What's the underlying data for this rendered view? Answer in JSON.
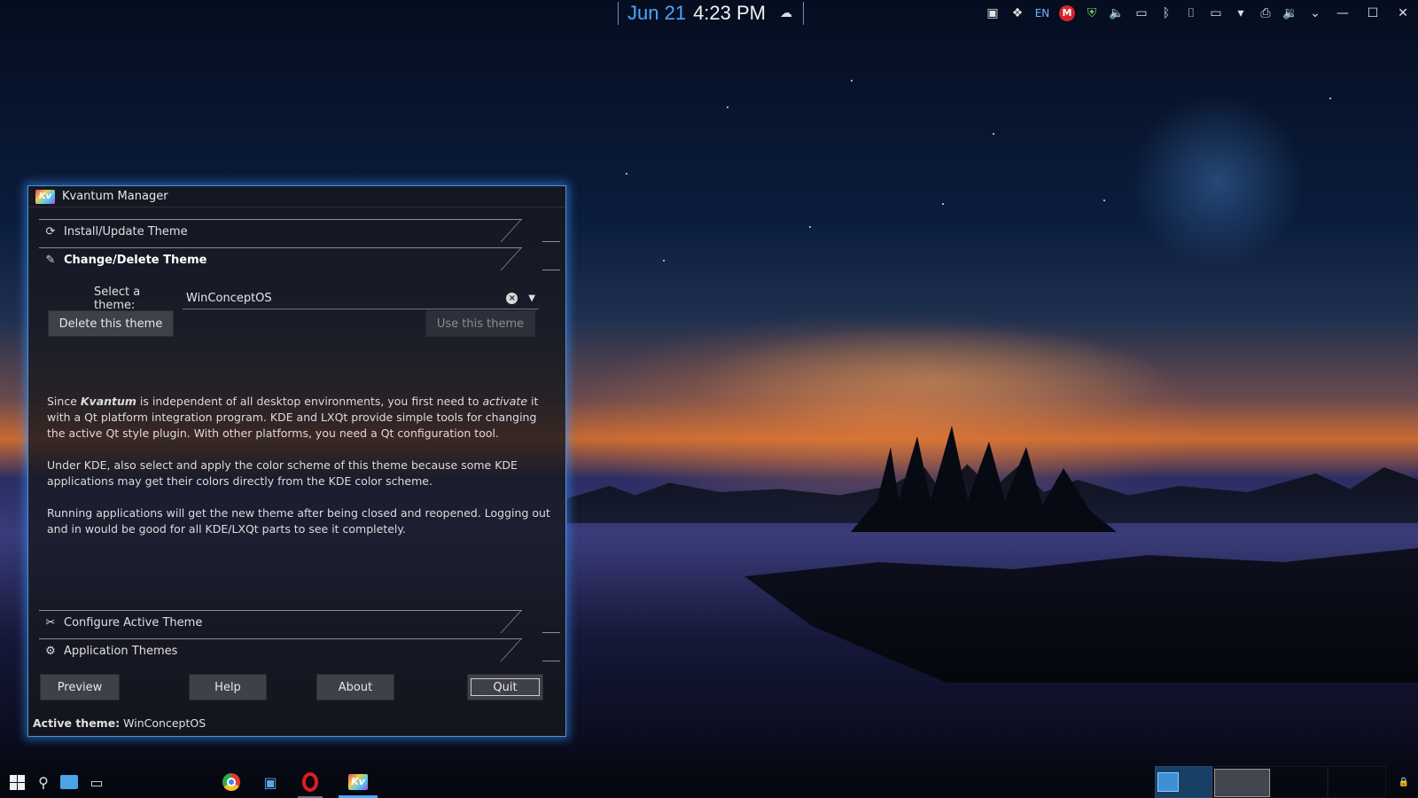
{
  "top_bar": {
    "date": "Jun 21",
    "time": "4:23 PM",
    "tray": [
      "chat-icon",
      "dropbox-icon",
      "EN",
      "M",
      "shield-icon",
      "volume-icon",
      "battery-icon",
      "bluetooth-icon",
      "usb-icon",
      "display-icon",
      "wifi-icon",
      "printer-icon",
      "speaker-icon",
      "chevron-down-icon"
    ],
    "window_controls": [
      "minimize-icon",
      "maximize-icon",
      "close-icon"
    ]
  },
  "window": {
    "title": "Kvantum Manager",
    "sections": {
      "install": "Install/Update Theme",
      "change": "Change/Delete Theme",
      "configure": "Configure Active Theme",
      "app_themes": "Application Themes"
    },
    "select_label": "Select a theme:",
    "selected_theme": "WinConceptOS",
    "delete_button": "Delete this theme",
    "use_button": "Use this theme",
    "info": {
      "p1_a": "Since ",
      "p1_kvantum": "Kvantum",
      "p1_b": " is independent of all desktop environments, you first need to ",
      "p1_activate": "activate",
      "p1_c": " it with a Qt platform integration program. KDE and LXQt provide simple tools for changing the active Qt style plugin. With other platforms, you need a Qt configuration tool.",
      "p2": "Under KDE, also select and apply the color scheme of this theme because some KDE applications may get their colors directly from the KDE color scheme.",
      "p3": "Running applications will get the new theme after being closed and reopened. Logging out and in would be good for all KDE/LXQt parts to see it completely."
    },
    "buttons": {
      "preview": "Preview",
      "help": "Help",
      "about": "About",
      "quit": "Quit"
    },
    "status_label": "Active theme:",
    "status_value": "WinConceptOS"
  },
  "taskbar": {
    "launchers": [
      "start-icon",
      "search-icon",
      "file-manager-icon",
      "task-view-icon"
    ],
    "apps": [
      "chrome-icon",
      "notes-icon",
      "opera-icon",
      "kvantum-icon"
    ]
  },
  "colors": {
    "accent": "#4da6ff",
    "window_border": "#4a90d9",
    "window_bg": "#16181e"
  }
}
